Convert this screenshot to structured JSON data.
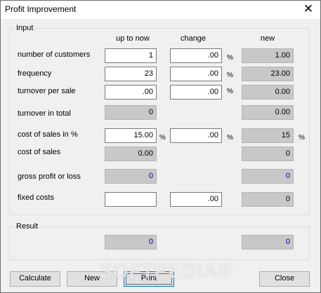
{
  "window": {
    "title": "Profit Improvement",
    "close_symbol": "✕"
  },
  "input_group": {
    "label": "Input",
    "columns": {
      "up_to_now": "up to now",
      "change": "change",
      "new": "new"
    },
    "rows": {
      "customers": {
        "label": "number of customers",
        "up_to_now": "1",
        "change": ".00",
        "new": "1.00"
      },
      "frequency": {
        "label": "frequency",
        "up_to_now": "23",
        "change": ".00",
        "new": "23.00"
      },
      "turnover_per_sale": {
        "label": "turnover per sale",
        "up_to_now": ".00",
        "change": ".00",
        "new": "0.00"
      },
      "turnover_total": {
        "label": "turnover in total",
        "up_to_now": "0",
        "new": "0.00"
      },
      "cost_pct": {
        "label": "cost of sales in %",
        "up_to_now": "15.00",
        "change": ".00",
        "new": "15"
      },
      "cost_of_sales": {
        "label": "cost of sales",
        "up_to_now": "0.00",
        "new": "0"
      },
      "gross_profit": {
        "label": "gross profit or loss",
        "up_to_now": "0",
        "new": "0"
      },
      "fixed_costs": {
        "label": "fixed costs",
        "up_to_now": "",
        "change": ".00",
        "new": "0"
      }
    },
    "percent_sign": "%"
  },
  "result_group": {
    "label": "Result",
    "up_to_now": "0",
    "new": "0"
  },
  "buttons": {
    "calculate": "Calculate",
    "new": "New",
    "print": "Print",
    "close": "Close"
  },
  "watermark": "SOFTPEDIA®",
  "colors": {
    "readonly_bg": "#c8c8c8",
    "value_blue": "#0000a8",
    "focus_border": "#0078d7"
  }
}
